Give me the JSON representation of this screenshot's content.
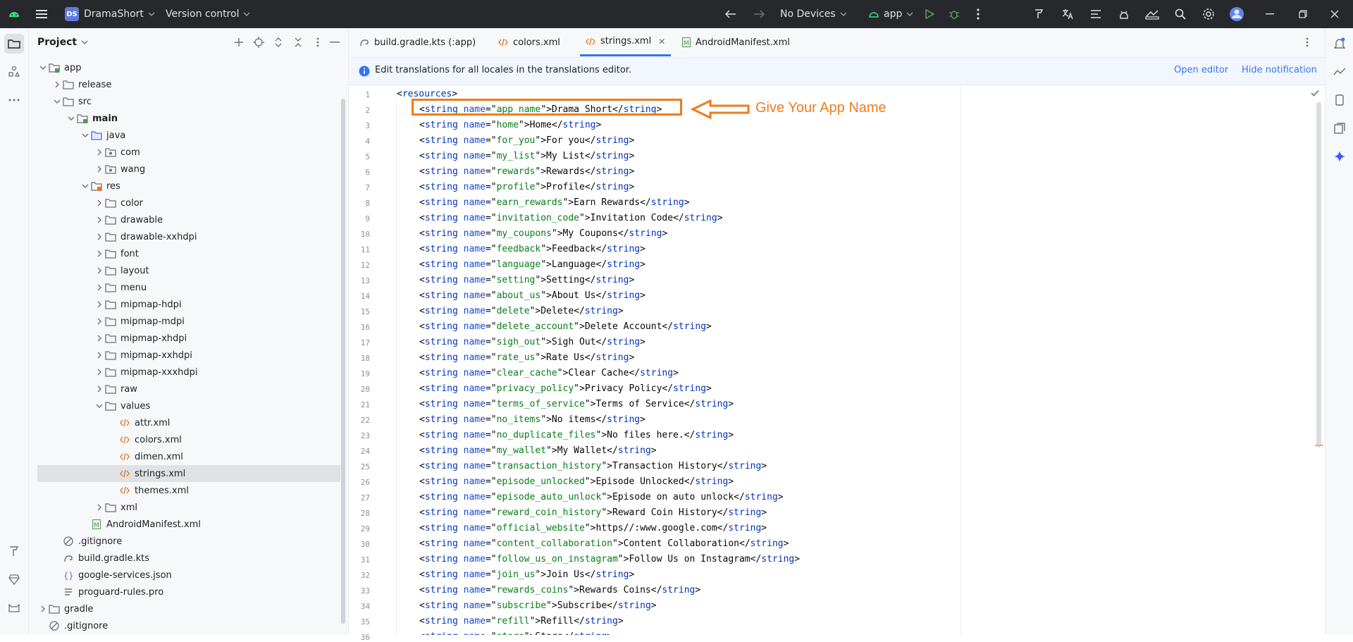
{
  "titlebar": {
    "project_initials": "DS",
    "project_name": "DramaShort",
    "vcs_label": "Version control",
    "device_label": "No Devices",
    "run_config": "app"
  },
  "project_panel": {
    "title": "Project",
    "tree": [
      {
        "label": "app",
        "type": "module",
        "expanded": true
      },
      {
        "label": "release",
        "type": "folder",
        "expanded": false
      },
      {
        "label": "src",
        "type": "folder",
        "expanded": true
      },
      {
        "label": "main",
        "type": "source-root",
        "expanded": true
      },
      {
        "label": "java",
        "type": "java-folder",
        "expanded": true
      },
      {
        "label": "com",
        "type": "package",
        "expanded": false
      },
      {
        "label": "wang",
        "type": "package",
        "expanded": false
      },
      {
        "label": "res",
        "type": "res-folder",
        "expanded": true
      },
      {
        "label": "color",
        "type": "folder",
        "expanded": false
      },
      {
        "label": "drawable",
        "type": "folder",
        "expanded": false
      },
      {
        "label": "drawable-xxhdpi",
        "type": "folder",
        "expanded": false
      },
      {
        "label": "font",
        "type": "folder",
        "expanded": false
      },
      {
        "label": "layout",
        "type": "folder",
        "expanded": false
      },
      {
        "label": "menu",
        "type": "folder",
        "expanded": false
      },
      {
        "label": "mipmap-hdpi",
        "type": "folder",
        "expanded": false
      },
      {
        "label": "mipmap-mdpi",
        "type": "folder",
        "expanded": false
      },
      {
        "label": "mipmap-xhdpi",
        "type": "folder",
        "expanded": false
      },
      {
        "label": "mipmap-xxhdpi",
        "type": "folder",
        "expanded": false
      },
      {
        "label": "mipmap-xxxhdpi",
        "type": "folder",
        "expanded": false
      },
      {
        "label": "raw",
        "type": "folder",
        "expanded": false
      },
      {
        "label": "values",
        "type": "folder",
        "expanded": true
      },
      {
        "label": "attr.xml",
        "type": "xml"
      },
      {
        "label": "colors.xml",
        "type": "xml"
      },
      {
        "label": "dimen.xml",
        "type": "xml"
      },
      {
        "label": "strings.xml",
        "type": "xml",
        "selected": true
      },
      {
        "label": "themes.xml",
        "type": "xml"
      },
      {
        "label": "xml",
        "type": "folder",
        "expanded": false
      },
      {
        "label": "AndroidManifest.xml",
        "type": "manifest"
      },
      {
        "label": ".gitignore",
        "type": "ignore"
      },
      {
        "label": "build.gradle.kts",
        "type": "gradle"
      },
      {
        "label": "google-services.json",
        "type": "json"
      },
      {
        "label": "proguard-rules.pro",
        "type": "text"
      },
      {
        "label": "gradle",
        "type": "folder",
        "expanded": false
      },
      {
        "label": ".gitignore",
        "type": "ignore"
      }
    ]
  },
  "tabs": [
    {
      "label": "build.gradle.kts (:app)",
      "icon": "gradle-icon"
    },
    {
      "label": "colors.xml",
      "icon": "xml-icon"
    },
    {
      "label": "strings.xml",
      "icon": "xml-icon",
      "active": true
    },
    {
      "label": "AndroidManifest.xml",
      "icon": "manifest-icon"
    }
  ],
  "notification": {
    "text": "Edit translations for all locales in the translations editor.",
    "open_editor": "Open editor",
    "hide": "Hide notification"
  },
  "annotation": {
    "text": "Give Your App Name",
    "color": "#f07b1d"
  },
  "editor": {
    "root_open": "resources",
    "strings": [
      {
        "name": "app_name",
        "value": "Drama Short"
      },
      {
        "name": "home",
        "value": "Home"
      },
      {
        "name": "for_you",
        "value": "For you"
      },
      {
        "name": "my_list",
        "value": "My List"
      },
      {
        "name": "rewards",
        "value": "Rewards"
      },
      {
        "name": "profile",
        "value": "Profile"
      },
      {
        "name": "earn_rewards",
        "value": "Earn Rewards"
      },
      {
        "name": "invitation_code",
        "value": "Invitation Code"
      },
      {
        "name": "my_coupons",
        "value": "My Coupons"
      },
      {
        "name": "feedback",
        "value": "Feedback"
      },
      {
        "name": "language",
        "value": "Language"
      },
      {
        "name": "setting",
        "value": "Setting"
      },
      {
        "name": "about_us",
        "value": "About Us"
      },
      {
        "name": "delete",
        "value": "Delete"
      },
      {
        "name": "delete_account",
        "value": "Delete Account"
      },
      {
        "name": "sigh_out",
        "value": "Sigh Out"
      },
      {
        "name": "rate_us",
        "value": "Rate Us"
      },
      {
        "name": "clear_cache",
        "value": "Clear Cache"
      },
      {
        "name": "privacy_policy",
        "value": "Privacy Policy"
      },
      {
        "name": "terms_of_service",
        "value": "Terms of Service"
      },
      {
        "name": "no_items",
        "value": "No items"
      },
      {
        "name": "no_duplicate_files",
        "value": "No files here."
      },
      {
        "name": "my_wallet",
        "value": "My Wallet"
      },
      {
        "name": "transaction_history",
        "value": "Transaction History"
      },
      {
        "name": "episode_unlocked",
        "value": "Episode Unlocked"
      },
      {
        "name": "episode_auto_unlock",
        "value": "Episode on auto unlock"
      },
      {
        "name": "reward_coin_history",
        "value": "Reward Coin History"
      },
      {
        "name": "official_website",
        "value": "https//:www.google.com"
      },
      {
        "name": "content_collaboration",
        "value": "Content Collaboration"
      },
      {
        "name": "follow_us_on_instagram",
        "value": "Follow Us on Instagram"
      },
      {
        "name": "join_us",
        "value": "Join Us"
      },
      {
        "name": "rewards_coins",
        "value": "Rewards Coins"
      },
      {
        "name": "subscribe",
        "value": "Subscribe"
      },
      {
        "name": "refill",
        "value": "Refill"
      },
      {
        "name": "store",
        "value": "Store"
      }
    ]
  },
  "colors": {
    "titlebar_bg": "#27282c",
    "accent": "#3574f0",
    "annotation": "#f07b1d",
    "xml_tag": "#0033b3",
    "xml_attr_value": "#067d17"
  }
}
